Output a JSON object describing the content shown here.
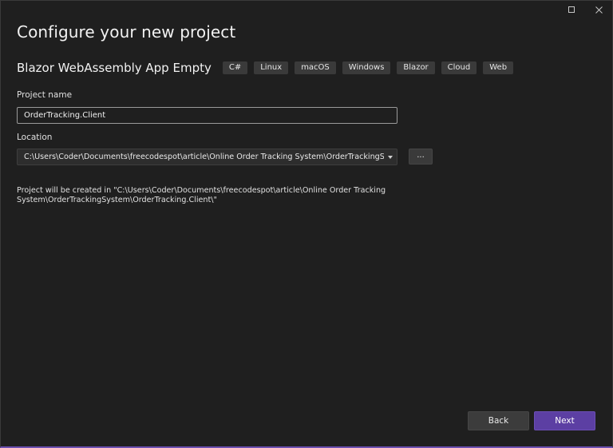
{
  "window": {
    "maximize_label": "",
    "close_label": ""
  },
  "heading": "Configure your new project",
  "template": {
    "name": "Blazor WebAssembly App Empty",
    "tags": [
      "C#",
      "Linux",
      "macOS",
      "Windows",
      "Blazor",
      "Cloud",
      "Web"
    ]
  },
  "project_name": {
    "label": "Project name",
    "value": "OrderTracking.Client"
  },
  "location": {
    "label": "Location",
    "value": "C:\\Users\\Coder\\Documents\\freecodespot\\article\\Online Order Tracking System\\OrderTrackingSyste",
    "browse_label": "..."
  },
  "summary": {
    "line1": "Project will be created in \"C:\\Users\\Coder\\Documents\\freecodespot\\article\\Online Order Tracking",
    "line2": "System\\OrderTrackingSystem\\OrderTracking.Client\\\""
  },
  "buttons": {
    "back": "Back",
    "next": "Next"
  },
  "colors": {
    "background": "#1f1f1f",
    "accent": "#5c3fa3",
    "tag_bg": "#3a3a3a"
  }
}
